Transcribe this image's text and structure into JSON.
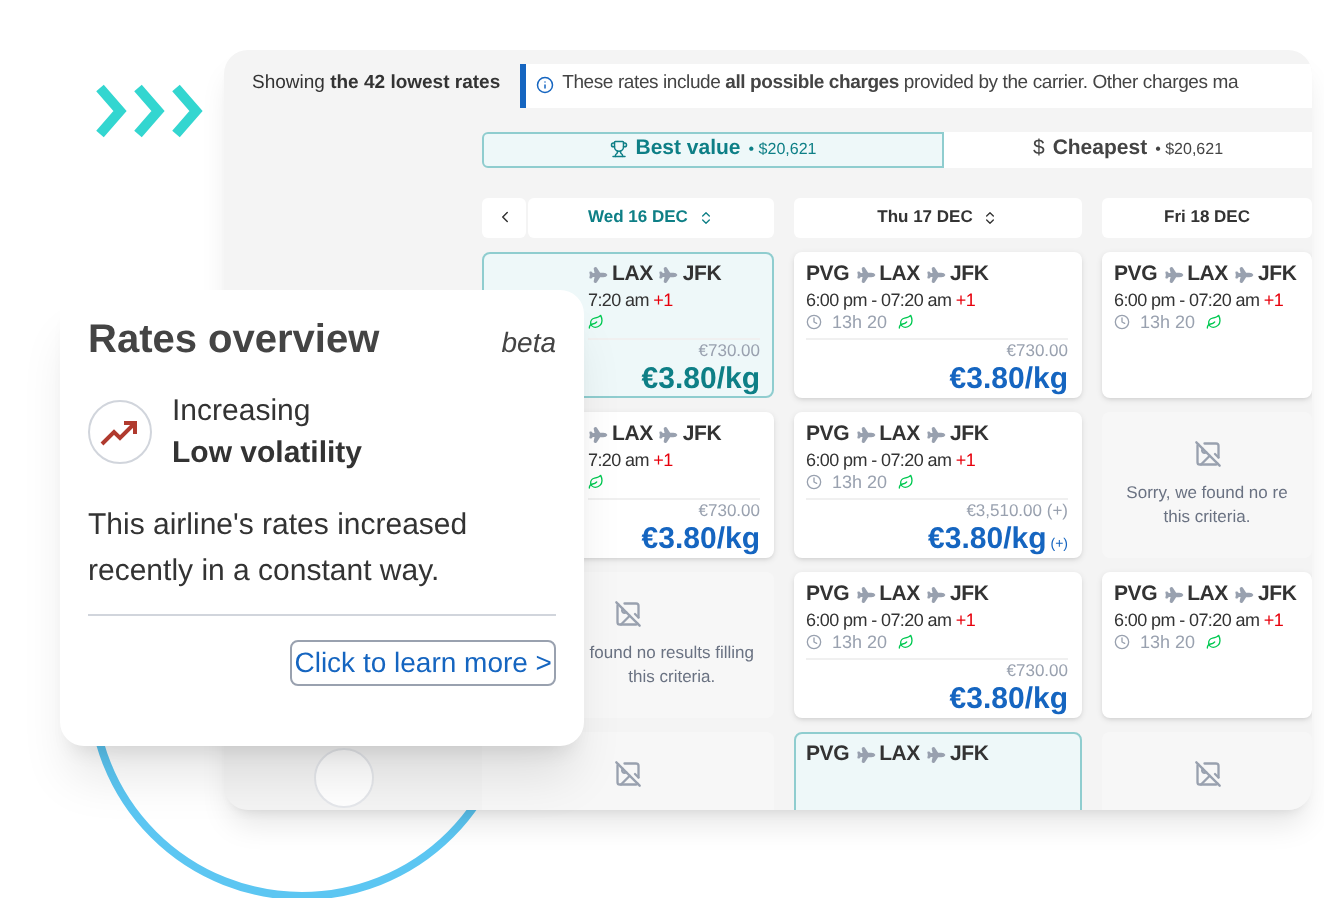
{
  "summary": "Showing **the 42 lowest rates**",
  "info": "These rates include **all possible charges** provided by the carrier. Other charges ma",
  "tabs": [
    {
      "kind": "trophy",
      "label": "Best value",
      "amount": "• $20,621",
      "selected": true
    },
    {
      "kind": "symbol",
      "symbol": "$",
      "label": "Cheapest",
      "amount": "• $20,621",
      "selected": false
    }
  ],
  "days": [
    {
      "label": "Wed 16 DEC",
      "selected": true,
      "sortable": true
    },
    {
      "label": "Thu 17 DEC",
      "selected": false,
      "sortable": true
    },
    {
      "label": "Fri 18 DEC",
      "selected": false,
      "sortable": false
    }
  ],
  "rows": [
    [
      {
        "kind": "covered",
        "selected": true,
        "route": [
          "LAX",
          "JFK"
        ],
        "times": "7:20 am",
        "next_day": "+1",
        "eco": true,
        "old_price": "€730.00",
        "price": "€3.80/kg"
      },
      {
        "kind": "flight",
        "selected": false,
        "route": [
          "PVG",
          "LAX",
          "JFK"
        ],
        "times": "6:00 pm - 07:20 am",
        "next_day": "+1",
        "duration": "13h 20",
        "eco": true,
        "old_price": "€730.00",
        "price": "€3.80/kg"
      },
      {
        "kind": "flight",
        "selected": false,
        "route": [
          "PVG",
          "LAX",
          "JFK"
        ],
        "times": "6:00 pm - 07:20 am",
        "next_day": "+1",
        "duration": "13h 20",
        "eco": true
      }
    ],
    [
      {
        "kind": "covered",
        "selected": false,
        "route": [
          "LAX",
          "JFK"
        ],
        "times": "7:20 am",
        "next_day": "+1",
        "eco": true,
        "old_price": "€730.00",
        "price": "€3.80/kg"
      },
      {
        "kind": "flight",
        "selected": false,
        "route": [
          "PVG",
          "LAX",
          "JFK"
        ],
        "times": "6:00 pm - 07:20 am",
        "next_day": "+1",
        "duration": "13h 20",
        "eco": true,
        "old_price": "€3,510.00 (+)",
        "price": "€3.80/kg",
        "note": "(+)"
      },
      {
        "kind": "empty",
        "lines": [
          "Sorry, we found no re",
          "this criteria."
        ]
      }
    ],
    [
      {
        "kind": "partial",
        "lines": [
          "found no results filling",
          "this criteria."
        ]
      },
      {
        "kind": "flight",
        "selected": false,
        "route": [
          "PVG",
          "LAX",
          "JFK"
        ],
        "times": "6:00 pm - 07:20 am",
        "next_day": "+1",
        "duration": "13h 20",
        "eco": true,
        "old_price": "€730.00",
        "price": "€3.80/kg"
      },
      {
        "kind": "flight",
        "selected": false,
        "route": [
          "PVG",
          "LAX",
          "JFK"
        ],
        "times": "6:00 pm - 07:20 am",
        "next_day": "+1",
        "duration": "13h 20",
        "eco": true
      }
    ],
    [
      {
        "kind": "empty"
      },
      {
        "kind": "flight",
        "selected": true,
        "route": [
          "PVG",
          "LAX",
          "JFK"
        ]
      },
      {
        "kind": "empty"
      }
    ]
  ],
  "overview": {
    "title": "Rates overview",
    "badge": "beta",
    "trend": "Increasing",
    "volatility": "Low volatility",
    "description": "This airline's rates increased recently in a constant way.",
    "link": "Click to learn more >"
  }
}
